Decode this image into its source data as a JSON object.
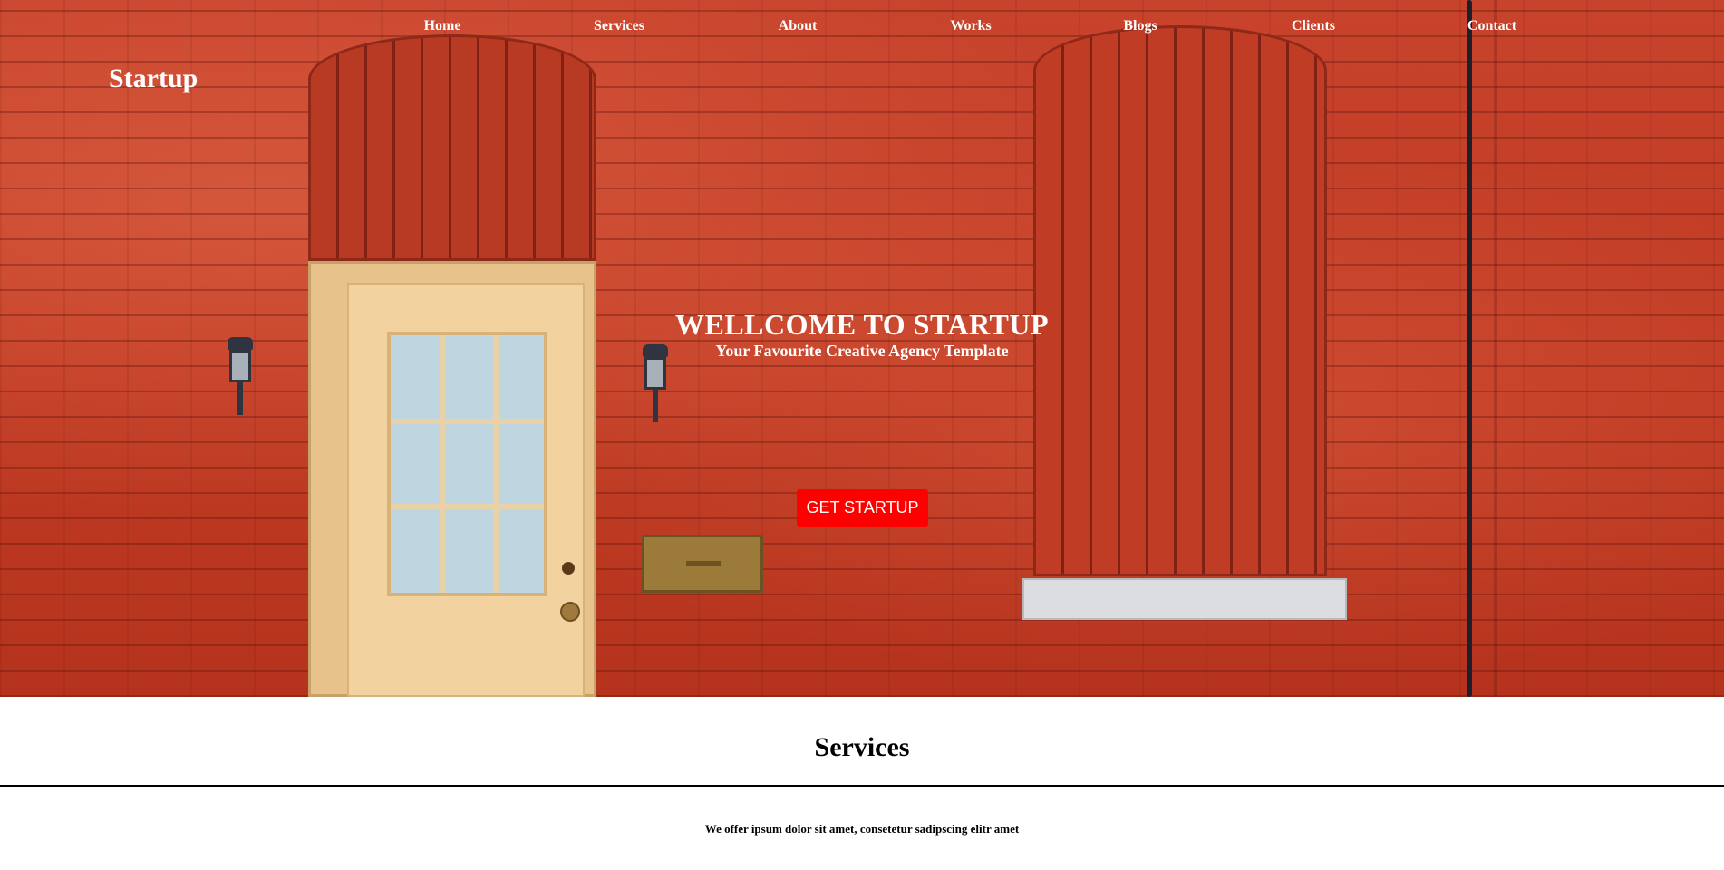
{
  "header": {
    "logo": "Startup",
    "nav": [
      {
        "label": "Home"
      },
      {
        "label": "Services"
      },
      {
        "label": "About"
      },
      {
        "label": "Works"
      },
      {
        "label": "Blogs"
      },
      {
        "label": "Clients"
      },
      {
        "label": "Contact"
      }
    ]
  },
  "hero": {
    "title": "WELLCOME TO STARTUP",
    "subtitle": "Your Favourite Creative Agency Template",
    "cta_label": "GET STARTUP",
    "colors": {
      "cta": "#ff0000",
      "wall": "#c13b24",
      "text": "#ffffff"
    }
  },
  "services": {
    "heading": "Services",
    "description": "We offer ipsum dolor sit amet, consetetur sadipscing elitr amet"
  },
  "icons": [
    "wall-lamp-icon",
    "mailbox-icon"
  ]
}
